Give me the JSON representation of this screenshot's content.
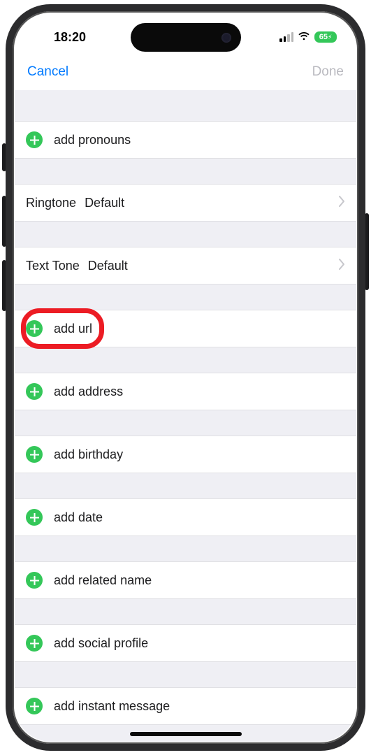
{
  "status": {
    "time": "18:20",
    "battery": "65"
  },
  "nav": {
    "cancel": "Cancel",
    "done": "Done"
  },
  "rows": {
    "pronouns": "add pronouns",
    "ringtone_key": "Ringtone",
    "ringtone_value": "Default",
    "texttone_key": "Text Tone",
    "texttone_value": "Default",
    "url": "add url",
    "address": "add address",
    "birthday": "add birthday",
    "date": "add date",
    "related": "add related name",
    "social": "add social profile",
    "instant": "add instant message"
  }
}
